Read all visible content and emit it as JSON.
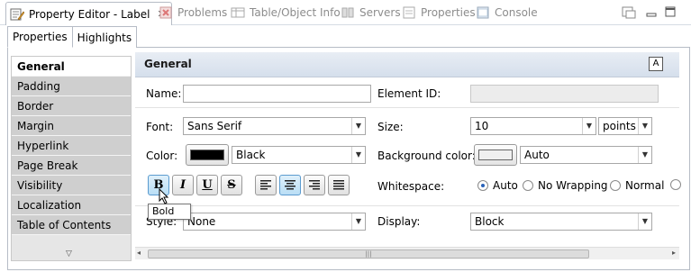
{
  "view_tabs": [
    {
      "label": "Property Editor - Label",
      "icon": "property-editor-icon",
      "active": true
    },
    {
      "label": "Problems",
      "icon": "problems-icon"
    },
    {
      "label": "Table/Object Info",
      "icon": "table-icon"
    },
    {
      "label": "Servers",
      "icon": "servers-icon"
    },
    {
      "label": "Properties",
      "icon": "properties-icon"
    },
    {
      "label": "Console",
      "icon": "console-icon"
    }
  ],
  "sub_tabs": [
    "Properties",
    "Highlights"
  ],
  "categories": [
    "General",
    "Padding",
    "Border",
    "Margin",
    "Hyperlink",
    "Page Break",
    "Visibility",
    "Localization",
    "Table of Contents"
  ],
  "section": {
    "title": "General"
  },
  "form": {
    "name_label": "Name:",
    "name_value": "",
    "element_id_label": "Element ID:",
    "element_id_value": "",
    "font_label": "Font:",
    "font_value": "Sans Serif",
    "size_label": "Size:",
    "size_value": "10",
    "size_unit": "points",
    "color_label": "Color:",
    "color_swatch": "#000000",
    "color_value": "Black",
    "bg_color_label": "Background color:",
    "bg_color_swatch": "#f0f0f0",
    "bg_color_value": "Auto",
    "format_buttons": {
      "bold": "B",
      "italic": "I",
      "underline": "U",
      "strike": "S"
    },
    "whitespace_label": "Whitespace:",
    "whitespace_options": [
      "Auto",
      "No Wrapping",
      "Normal"
    ],
    "whitespace_selected": "Auto",
    "style_label": "Style:",
    "style_value": "None",
    "display_label": "Display:",
    "display_value": "Block"
  },
  "tooltip": "Bold",
  "colors": {
    "accent": "#2a62b9",
    "section_header": "#d5dfec",
    "list_bg": "#cfcfcf"
  }
}
